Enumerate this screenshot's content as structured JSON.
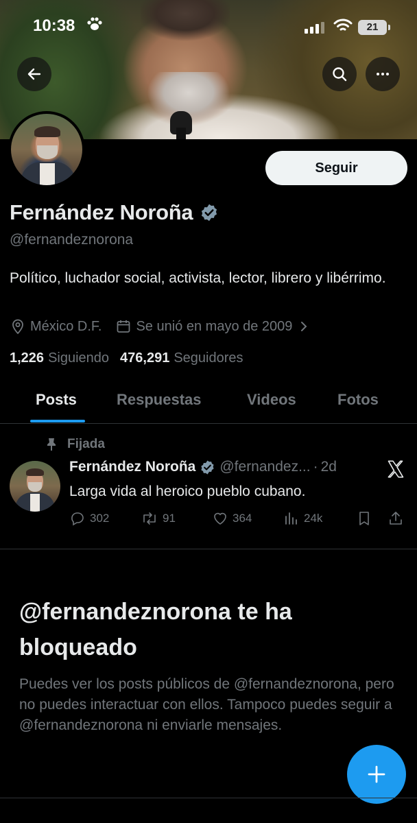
{
  "status_bar": {
    "time": "10:38",
    "battery": "21"
  },
  "header": {
    "back_icon": "arrow-left-icon",
    "search_icon": "search-icon",
    "more_icon": "more-horizontal-icon"
  },
  "profile": {
    "follow_label": "Seguir",
    "display_name": "Fernández Noroña",
    "handle": "@fernandeznorona",
    "bio": "Político, luchador social, activista, lector, librero y libérrimo.",
    "location": "México D.F.",
    "joined": "Se unió en mayo de 2009",
    "following_count": "1,226",
    "following_label": "Siguiendo",
    "followers_count": "476,291",
    "followers_label": "Seguidores"
  },
  "tabs": [
    {
      "label": "Posts",
      "active": true
    },
    {
      "label": "Respuestas",
      "active": false
    },
    {
      "label": "Videos",
      "active": false
    },
    {
      "label": "Fotos",
      "active": false
    }
  ],
  "pinned_post": {
    "pinned_label": "Fijada",
    "author_name": "Fernández Noroña",
    "author_handle": "@fernandez...",
    "dot": "·",
    "time": "2d",
    "text": "Larga vida al heroico pueblo cubano.",
    "replies": "302",
    "reposts": "91",
    "likes": "364",
    "views": "24k"
  },
  "blocked": {
    "title": "@fernandeznorona te ha bloqueado",
    "body": "Puedes ver los posts públicos de @fernandeznorona, pero no puedes interactuar con ellos. Tampoco puedes seguir a @fernandeznorona ni enviarle mensajes."
  },
  "colors": {
    "accent": "#1d9bf0",
    "muted": "#71767b",
    "text": "#e7e9ea",
    "background": "#000000"
  }
}
